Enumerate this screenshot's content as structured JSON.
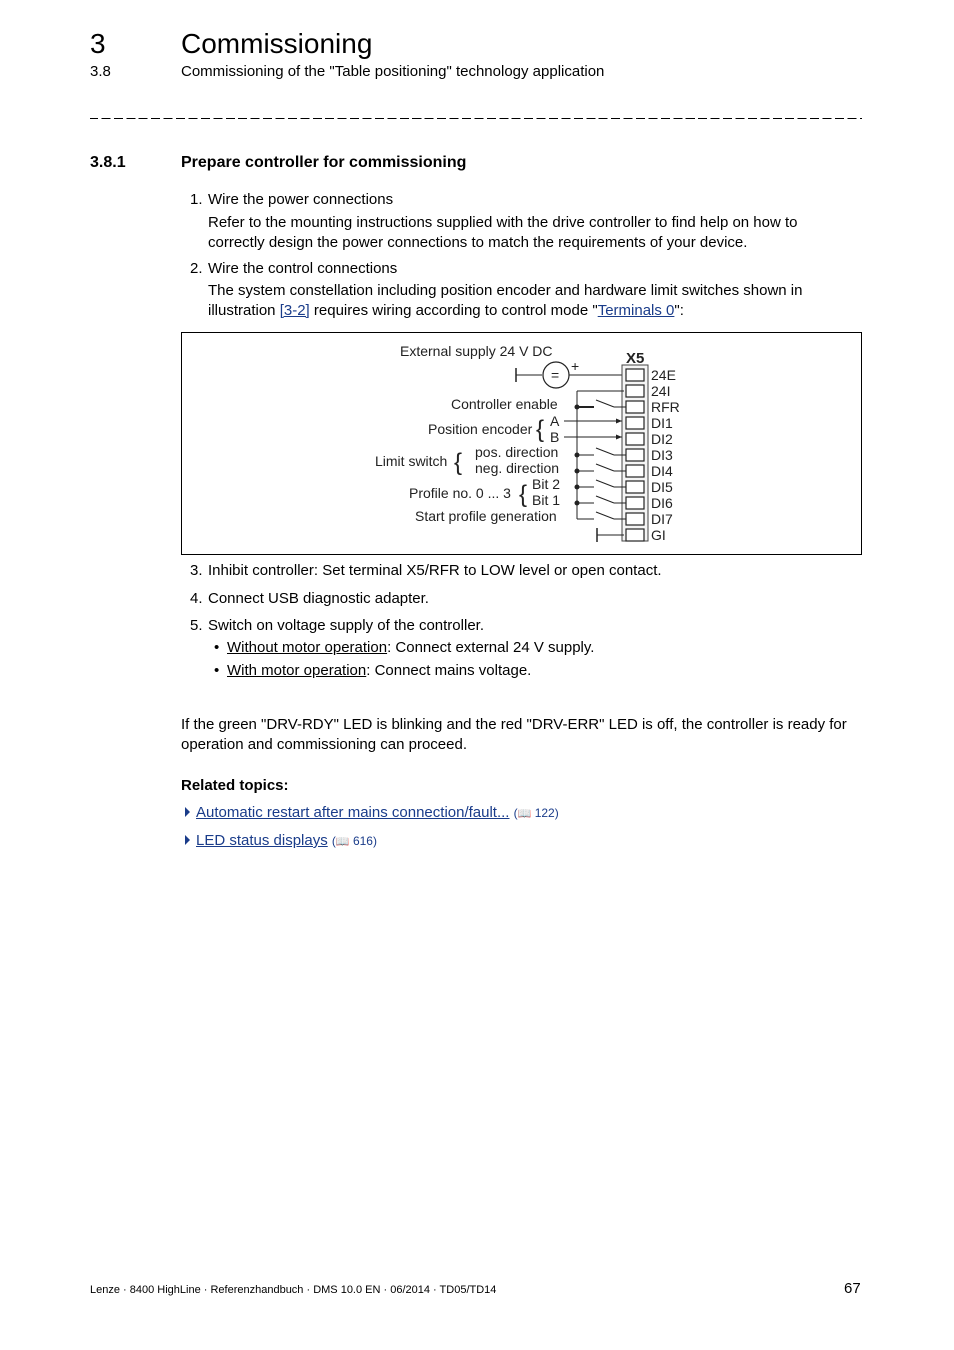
{
  "header": {
    "chapter_number": "3",
    "chapter_title": "Commissioning",
    "section_number": "3.8",
    "section_title": "Commissioning of the \"Table positioning\" technology application"
  },
  "subsection": {
    "number": "3.8.1",
    "title": "Prepare controller for commissioning"
  },
  "steps": [
    {
      "num": "1.",
      "title": "Wire the power connections",
      "body_lines": [
        "Refer to the mounting instructions supplied with the drive controller to find help on how to",
        "correctly design the power connections to match the requirements of your device."
      ]
    },
    {
      "num": "2.",
      "title": "Wire the control connections",
      "body_line1": "The system constellation including position encoder and hardware limit switches shown in",
      "body_line2_prefix": "illustration ",
      "body_link1": "[3-2]",
      "body_line2_mid": " requires wiring according to control mode \"",
      "body_link2": "Terminals 0",
      "body_line2_suffix": "\":"
    },
    {
      "num": "3.",
      "title": "Inhibit controller: Set terminal X5/RFR to LOW level or open contact."
    },
    {
      "num": "4.",
      "title": "Connect USB diagnostic adapter."
    },
    {
      "num": "5.",
      "title": "Switch on voltage supply of the controller.",
      "bullets": [
        {
          "label": "Without motor operation",
          "text": ": Connect external 24 V supply."
        },
        {
          "label": "With motor operation",
          "text": ": Connect mains voltage."
        }
      ]
    }
  ],
  "diagram": {
    "supply_label": "External supply 24 V DC",
    "source_symbol": "=",
    "plus": "+",
    "connector": "X5",
    "terminals": [
      "24E",
      "24I",
      "RFR",
      "DI1",
      "DI2",
      "DI3",
      "DI4",
      "DI5",
      "DI6",
      "DI7",
      "GI"
    ],
    "controller_enable": "Controller enable",
    "position_encoder": "Position encoder",
    "encoder_a": "A",
    "encoder_b": "B",
    "limit_switch": "Limit switch",
    "pos_direction": "pos. direction",
    "neg_direction": "neg. direction",
    "profile_no": "Profile no. 0 ... 3",
    "bit2": "Bit 2",
    "bit1": "Bit 1",
    "start_profile": "Start profile generation"
  },
  "final_paragraph": [
    "If the green \"DRV-RDY\" LED is blinking and the red \"DRV-ERR\" LED is off, the controller is ready for",
    "operation and commissioning can proceed."
  ],
  "related": {
    "heading": "Related topics:",
    "items": [
      {
        "label": "Automatic restart after mains connection/fault...",
        "page": "122"
      },
      {
        "label": "LED status displays",
        "page": "616"
      }
    ]
  },
  "footer": {
    "text": "Lenze · 8400 HighLine · Referenzhandbuch · DMS 10.0 EN · 06/2014 · TD05/TD14",
    "page_number": "67"
  }
}
